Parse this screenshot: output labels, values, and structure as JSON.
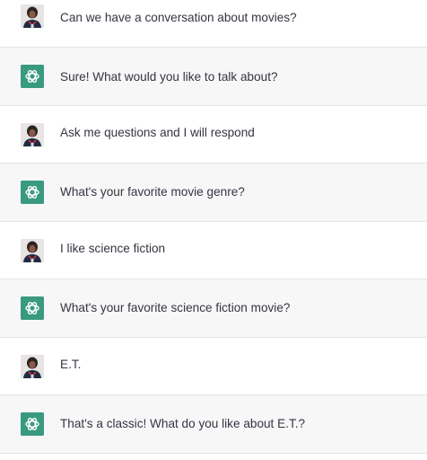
{
  "conversation": {
    "messages": [
      {
        "role": "user",
        "avatar_icon": "user-photo-avatar",
        "text": "Can we have a conversation about movies?"
      },
      {
        "role": "assistant",
        "avatar_icon": "chatgpt-logo-icon",
        "text": "Sure! What would you like to talk about?"
      },
      {
        "role": "user",
        "avatar_icon": "user-photo-avatar",
        "text": "Ask me questions and I will respond"
      },
      {
        "role": "assistant",
        "avatar_icon": "chatgpt-logo-icon",
        "text": "What's your favorite movie genre?"
      },
      {
        "role": "user",
        "avatar_icon": "user-photo-avatar",
        "text": "I like science fiction"
      },
      {
        "role": "assistant",
        "avatar_icon": "chatgpt-logo-icon",
        "text": "What's your favorite science fiction movie?"
      },
      {
        "role": "user",
        "avatar_icon": "user-photo-avatar",
        "text": "E.T."
      },
      {
        "role": "assistant",
        "avatar_icon": "chatgpt-logo-icon",
        "text": "That's a classic! What do you like about E.T.?"
      }
    ]
  },
  "colors": {
    "assistant_row_bg": "#f7f7f8",
    "user_row_bg": "#ffffff",
    "bot_avatar_bg": "#3a9a7f",
    "text": "#343541",
    "divider": "#e4e4e7"
  }
}
